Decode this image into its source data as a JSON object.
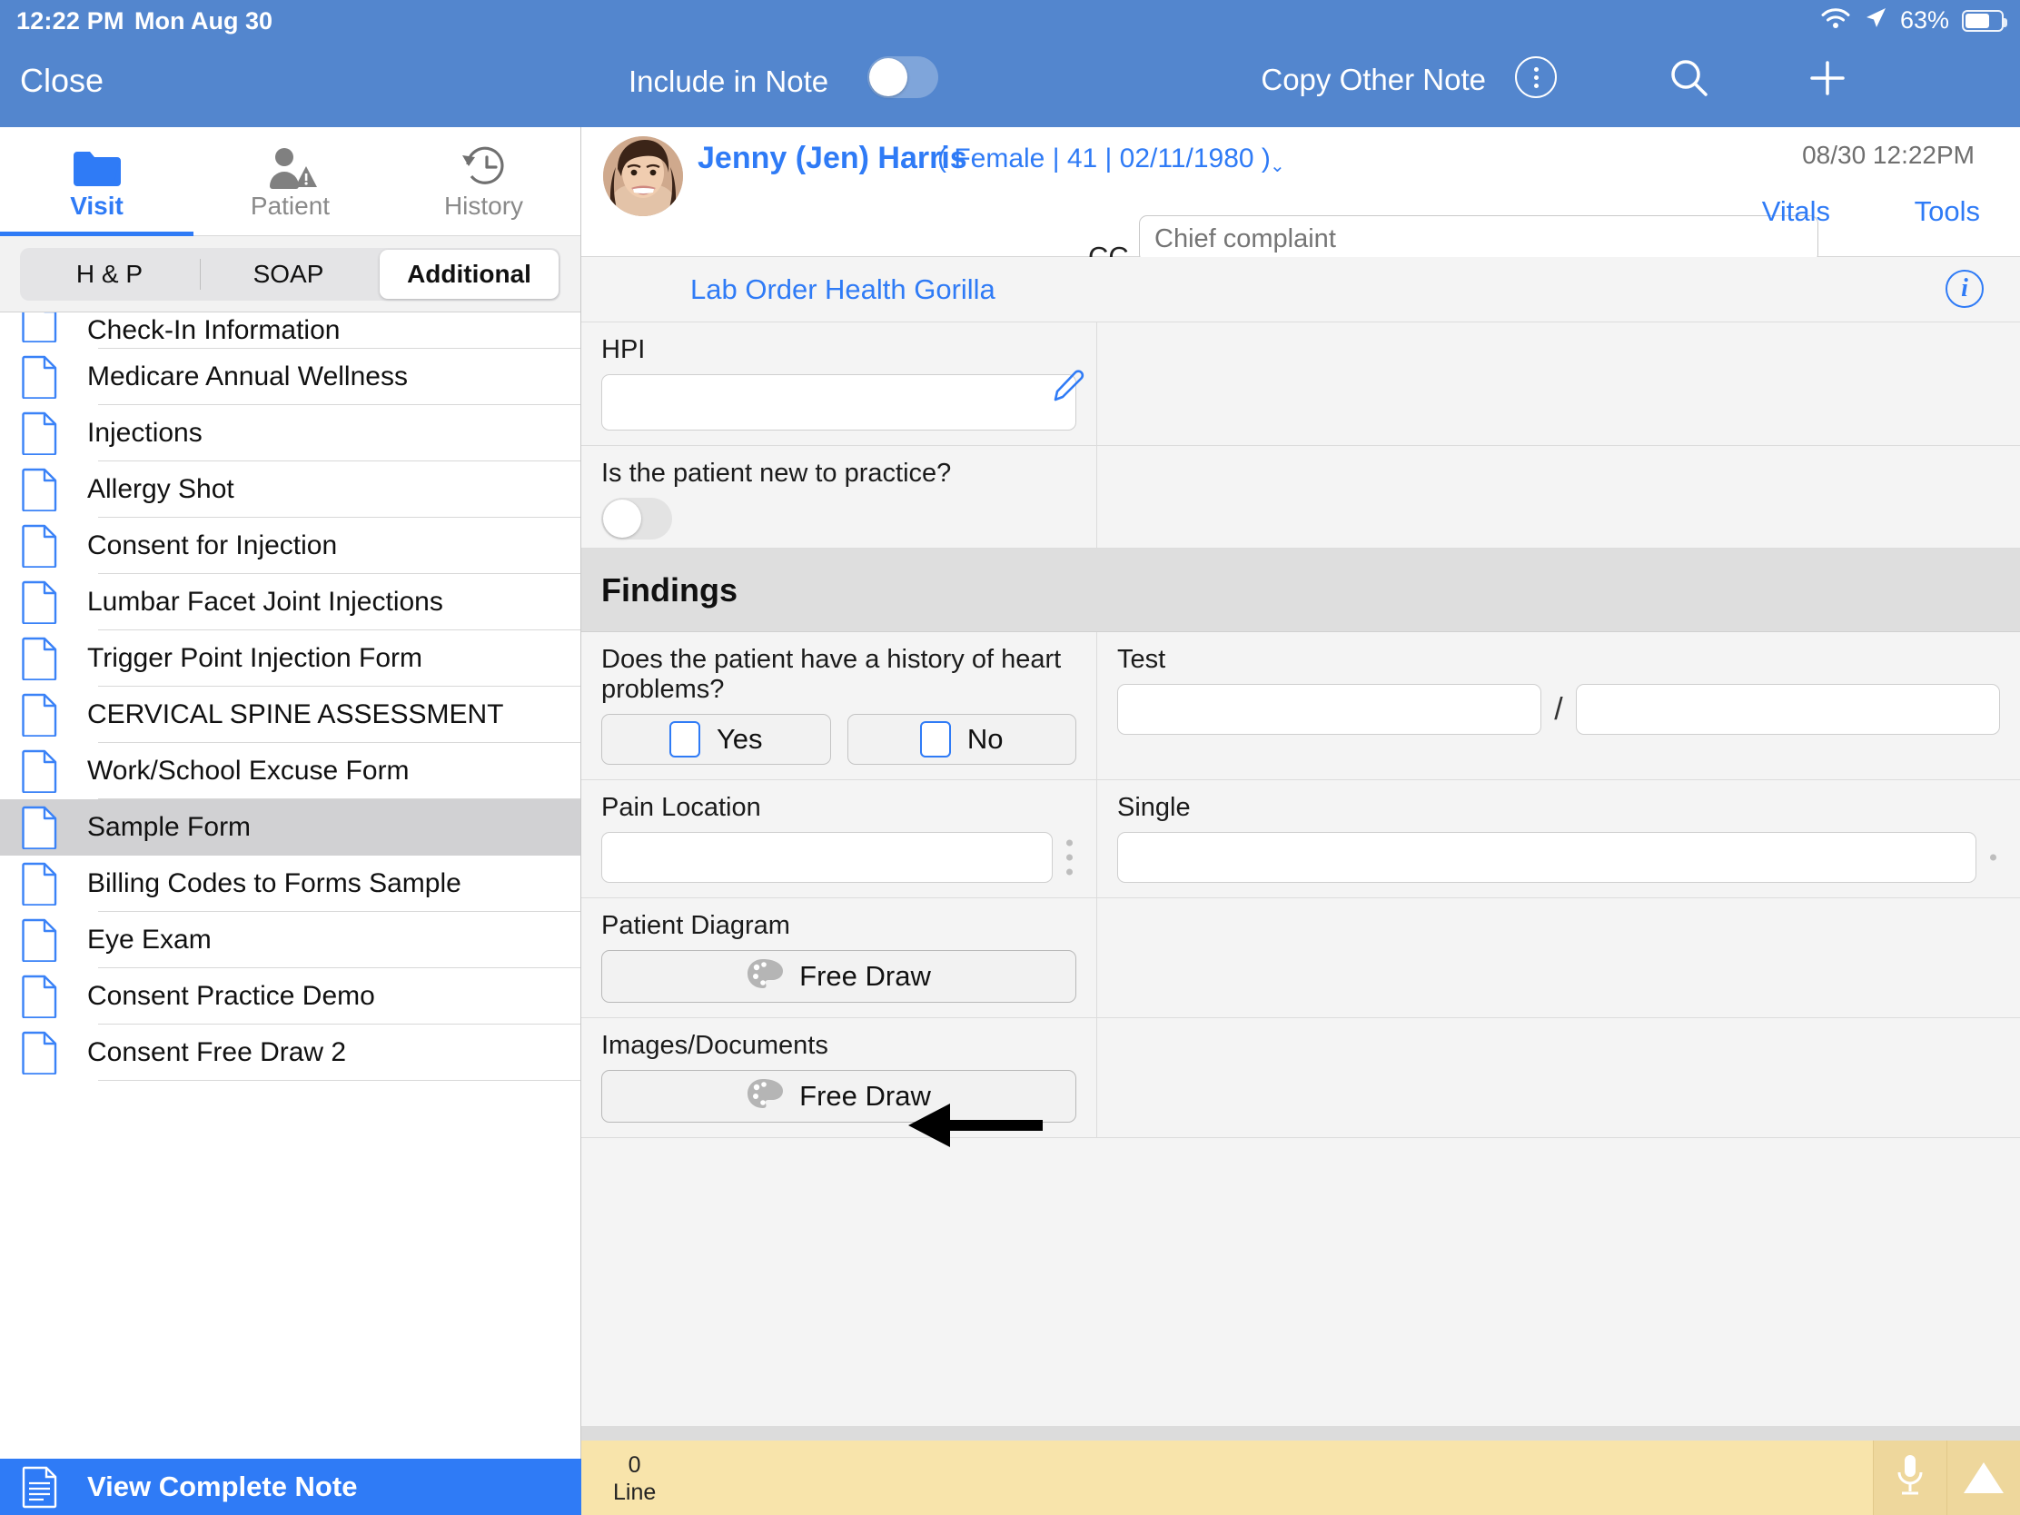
{
  "status_bar": {
    "time": "12:22 PM",
    "date": "Mon Aug 30",
    "battery_percent": "63%",
    "wifi_icon": "wifi-icon",
    "location_icon": "location-arrow-icon",
    "battery_icon": "battery-icon"
  },
  "topbar": {
    "close_label": "Close",
    "include_in_note_label": "Include in Note",
    "include_in_note_value": "off",
    "copy_other_note_label": "Copy Other Note",
    "more_icon": "more-vertical-circle-icon",
    "search_icon": "search-icon",
    "add_icon": "plus-icon"
  },
  "sidebar": {
    "tabs": [
      {
        "label": "Visit",
        "icon": "folder-icon",
        "active": true
      },
      {
        "label": "Patient",
        "icon": "person-warning-icon",
        "active": false
      },
      {
        "label": "History",
        "icon": "clock-history-icon",
        "active": false
      }
    ],
    "subtabs": [
      {
        "label": "H & P",
        "active": false
      },
      {
        "label": "SOAP",
        "active": false
      },
      {
        "label": "Additional",
        "active": true
      }
    ],
    "forms": [
      {
        "label": "Check-In Information",
        "selected": false,
        "partial": true
      },
      {
        "label": "Medicare Annual Wellness",
        "selected": false
      },
      {
        "label": "Injections",
        "selected": false
      },
      {
        "label": "Allergy Shot",
        "selected": false
      },
      {
        "label": "Consent for Injection",
        "selected": false
      },
      {
        "label": "Lumbar Facet Joint Injections",
        "selected": false
      },
      {
        "label": "Trigger Point Injection Form",
        "selected": false
      },
      {
        "label": "CERVICAL SPINE ASSESSMENT",
        "selected": false
      },
      {
        "label": "Work/School Excuse Form",
        "selected": false
      },
      {
        "label": "Sample Form",
        "selected": true
      },
      {
        "label": "Billing Codes to Forms Sample",
        "selected": false
      },
      {
        "label": "Eye Exam",
        "selected": false
      },
      {
        "label": "Consent Practice Demo",
        "selected": false
      },
      {
        "label": "Consent Free Draw 2",
        "selected": false
      }
    ],
    "view_complete_note_label": "View Complete Note"
  },
  "patient_header": {
    "name": "Jenny (Jen) Harris",
    "demographics": "( Female | 41 | 02/11/1980 )",
    "cc_label": "CC",
    "cc_placeholder": "Chief complaint",
    "cc_value": "",
    "timestamp": "08/30 12:22PM",
    "vitals_label": "Vitals",
    "tools_label": "Tools"
  },
  "form_toolbar": {
    "lab_order_label": "Lab Order",
    "health_gorilla_label": "Health Gorilla",
    "info_icon": "info-circle-icon"
  },
  "form": {
    "hpi": {
      "label": "HPI",
      "value": "",
      "edit_icon": "pencil-icon"
    },
    "new_patient": {
      "label": "Is the patient new to practice?",
      "value": "off"
    },
    "findings_section": "Findings",
    "heart_question": {
      "label": "Does the patient have a history of heart problems?",
      "options": [
        {
          "label": "Yes",
          "checked": false
        },
        {
          "label": "No",
          "checked": false
        }
      ]
    },
    "test": {
      "label": "Test",
      "value_left": "",
      "value_right": "",
      "separator": "/"
    },
    "pain_location": {
      "label": "Pain Location",
      "value": ""
    },
    "single": {
      "label": "Single",
      "value": ""
    },
    "patient_diagram": {
      "label": "Patient Diagram",
      "button_label": "Free Draw",
      "icon": "palette-icon"
    },
    "images_documents": {
      "label": "Images/Documents",
      "button_label": "Free Draw",
      "icon": "palette-icon"
    }
  },
  "bottombar": {
    "count": "0",
    "unit": "Line",
    "mic_icon": "microphone-icon",
    "expand_icon": "triangle-up-icon"
  },
  "annotation": {
    "arrow_icon": "left-arrow-annotation"
  },
  "colors": {
    "topbar_blue": "#5386ce",
    "accent_blue": "#2f7bf6",
    "selected_row": "#d1d1d3",
    "bottom_yellow": "#f8e4ab",
    "section_gray": "#dedede"
  }
}
